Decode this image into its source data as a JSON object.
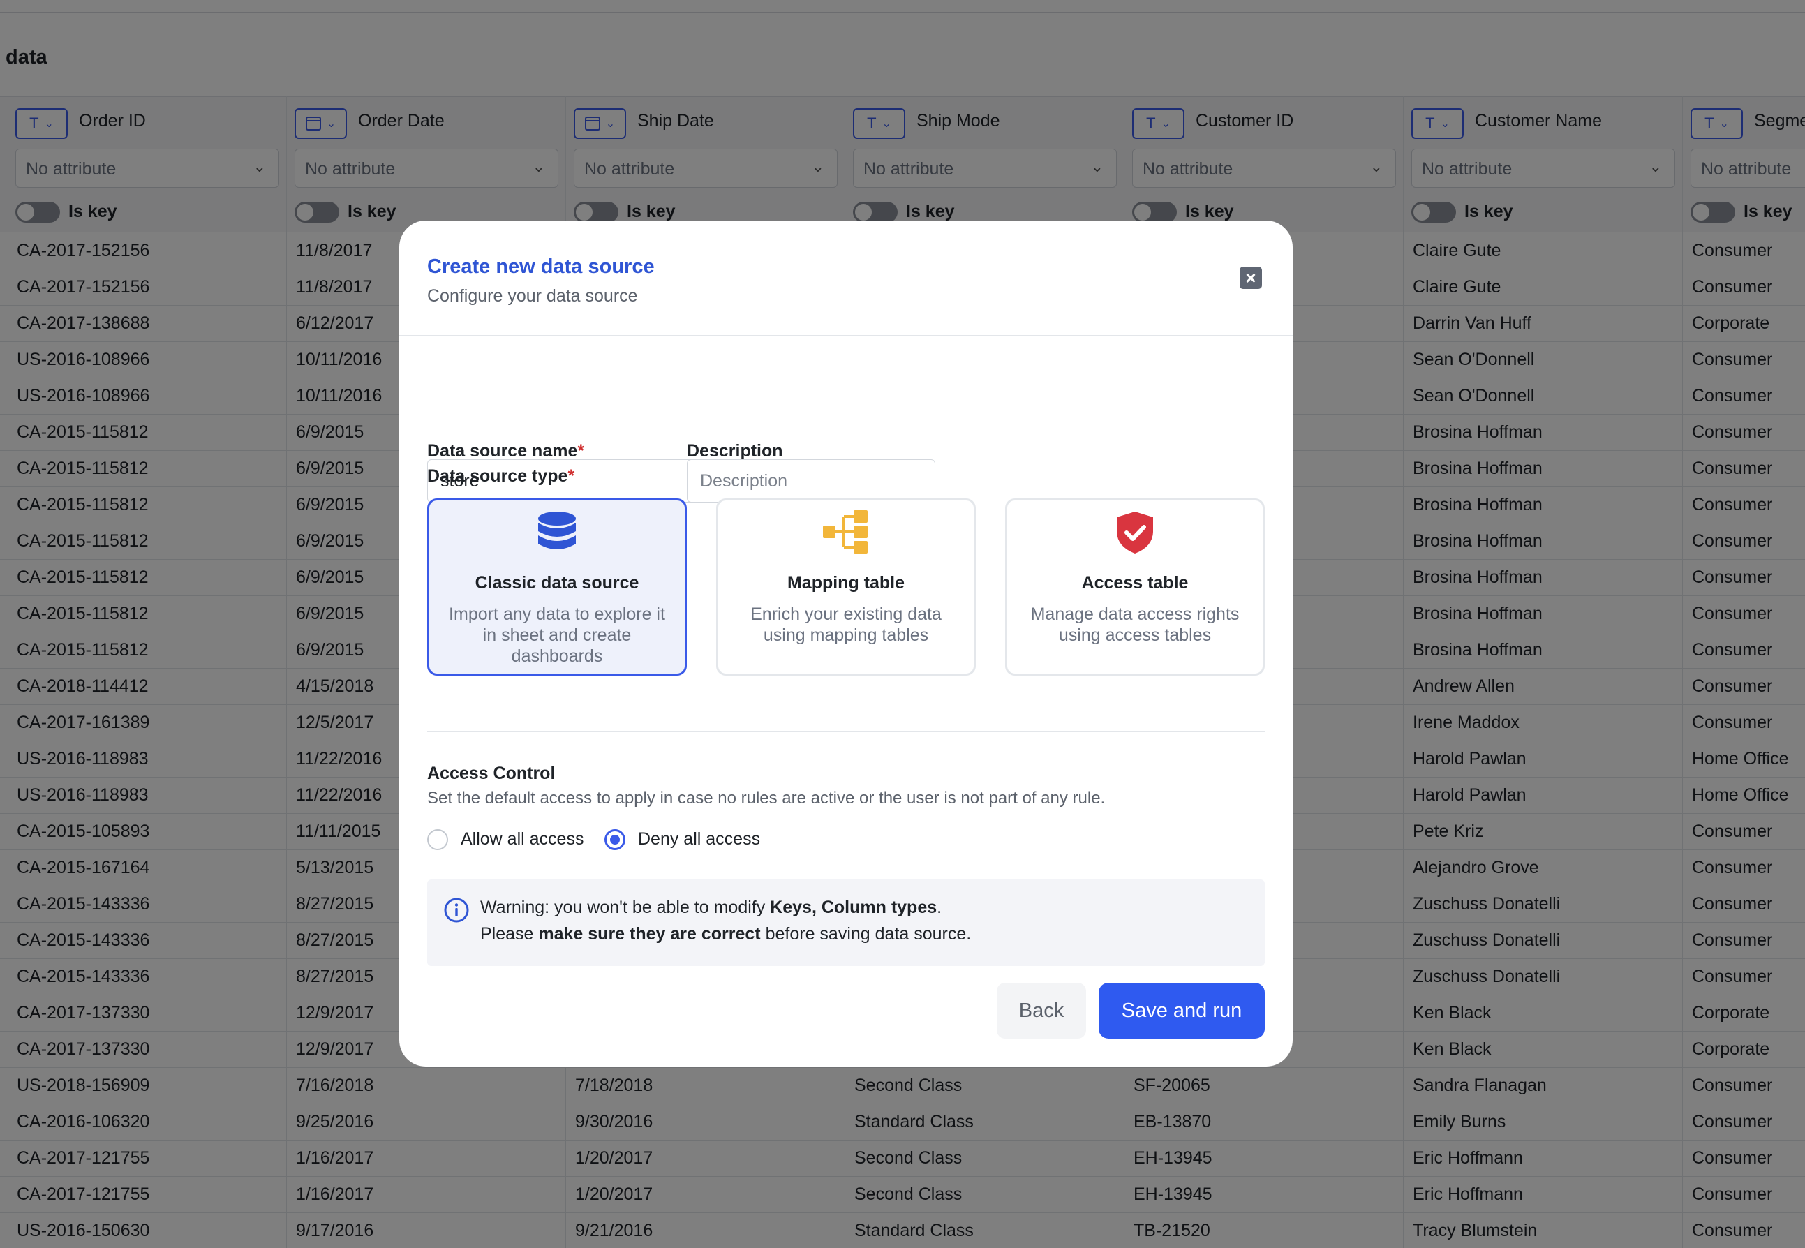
{
  "background": {
    "title": "data",
    "columns": [
      {
        "type_icon": "text-type-icon",
        "name": "Order ID",
        "attribute": "No attribute",
        "key_label": "Is key"
      },
      {
        "type_icon": "calendar-icon",
        "name": "Order Date",
        "attribute": "No attribute",
        "key_label": "Is key"
      },
      {
        "type_icon": "calendar-icon",
        "name": "Ship Date",
        "attribute": "No attribute",
        "key_label": "Is key"
      },
      {
        "type_icon": "text-type-icon",
        "name": "Ship Mode",
        "attribute": "No attribute",
        "key_label": "Is key"
      },
      {
        "type_icon": "text-type-icon",
        "name": "Customer ID",
        "attribute": "No attribute",
        "key_label": "Is key"
      },
      {
        "type_icon": "text-type-icon",
        "name": "Customer Name",
        "attribute": "No attribute",
        "key_label": "Is key"
      },
      {
        "type_icon": "text-type-icon",
        "name": "Segme",
        "attribute": "No attribute",
        "key_label": "Is key"
      }
    ],
    "rows": [
      [
        "CA-2017-152156",
        "11/8/2017",
        "",
        "",
        "",
        "Claire Gute",
        "Consumer"
      ],
      [
        "CA-2017-152156",
        "11/8/2017",
        "",
        "",
        "",
        "Claire Gute",
        "Consumer"
      ],
      [
        "CA-2017-138688",
        "6/12/2017",
        "",
        "",
        "",
        "Darrin Van Huff",
        "Corporate"
      ],
      [
        "US-2016-108966",
        "10/11/2016",
        "",
        "",
        "",
        "Sean O'Donnell",
        "Consumer"
      ],
      [
        "US-2016-108966",
        "10/11/2016",
        "",
        "",
        "",
        "Sean O'Donnell",
        "Consumer"
      ],
      [
        "CA-2015-115812",
        "6/9/2015",
        "",
        "",
        "",
        "Brosina Hoffman",
        "Consumer"
      ],
      [
        "CA-2015-115812",
        "6/9/2015",
        "",
        "",
        "",
        "Brosina Hoffman",
        "Consumer"
      ],
      [
        "CA-2015-115812",
        "6/9/2015",
        "",
        "",
        "",
        "Brosina Hoffman",
        "Consumer"
      ],
      [
        "CA-2015-115812",
        "6/9/2015",
        "",
        "",
        "",
        "Brosina Hoffman",
        "Consumer"
      ],
      [
        "CA-2015-115812",
        "6/9/2015",
        "",
        "",
        "",
        "Brosina Hoffman",
        "Consumer"
      ],
      [
        "CA-2015-115812",
        "6/9/2015",
        "",
        "",
        "",
        "Brosina Hoffman",
        "Consumer"
      ],
      [
        "CA-2015-115812",
        "6/9/2015",
        "",
        "",
        "",
        "Brosina Hoffman",
        "Consumer"
      ],
      [
        "CA-2018-114412",
        "4/15/2018",
        "",
        "",
        "",
        "Andrew Allen",
        "Consumer"
      ],
      [
        "CA-2017-161389",
        "12/5/2017",
        "",
        "",
        "",
        "Irene Maddox",
        "Consumer"
      ],
      [
        "US-2016-118983",
        "11/22/2016",
        "",
        "",
        "",
        "Harold Pawlan",
        "Home Office"
      ],
      [
        "US-2016-118983",
        "11/22/2016",
        "",
        "",
        "",
        "Harold Pawlan",
        "Home Office"
      ],
      [
        "CA-2015-105893",
        "11/11/2015",
        "",
        "",
        "",
        "Pete Kriz",
        "Consumer"
      ],
      [
        "CA-2015-167164",
        "5/13/2015",
        "",
        "",
        "",
        "Alejandro Grove",
        "Consumer"
      ],
      [
        "CA-2015-143336",
        "8/27/2015",
        "",
        "",
        "",
        "Zuschuss Donatelli",
        "Consumer"
      ],
      [
        "CA-2015-143336",
        "8/27/2015",
        "",
        "",
        "",
        "Zuschuss Donatelli",
        "Consumer"
      ],
      [
        "CA-2015-143336",
        "8/27/2015",
        "",
        "",
        "",
        "Zuschuss Donatelli",
        "Consumer"
      ],
      [
        "CA-2017-137330",
        "12/9/2017",
        "",
        "",
        "",
        "Ken Black",
        "Corporate"
      ],
      [
        "CA-2017-137330",
        "12/9/2017",
        "",
        "",
        "",
        "Ken Black",
        "Corporate"
      ],
      [
        "US-2018-156909",
        "7/16/2018",
        "7/18/2018",
        "Second Class",
        "SF-20065",
        "Sandra Flanagan",
        "Consumer"
      ],
      [
        "CA-2016-106320",
        "9/25/2016",
        "9/30/2016",
        "Standard Class",
        "EB-13870",
        "Emily Burns",
        "Consumer"
      ],
      [
        "CA-2017-121755",
        "1/16/2017",
        "1/20/2017",
        "Second Class",
        "EH-13945",
        "Eric Hoffmann",
        "Consumer"
      ],
      [
        "CA-2017-121755",
        "1/16/2017",
        "1/20/2017",
        "Second Class",
        "EH-13945",
        "Eric Hoffmann",
        "Consumer"
      ],
      [
        "US-2016-150630",
        "9/17/2016",
        "9/21/2016",
        "Standard Class",
        "TB-21520",
        "Tracy Blumstein",
        "Consumer"
      ]
    ]
  },
  "modal": {
    "title": "Create new data source",
    "subtitle": "Configure your data source",
    "close_icon": "close-icon",
    "name_label": "Data source name",
    "required_mark": "*",
    "name_value": "store",
    "description_label": "Description",
    "description_placeholder": "Description",
    "type_label": "Data source type",
    "types": [
      {
        "icon": "database-icon",
        "title": "Classic data source",
        "desc": "Import any data to explore it in sheet and create dashboards",
        "selected": true
      },
      {
        "icon": "mapping-icon",
        "title": "Mapping table",
        "desc": "Enrich your existing data using mapping tables",
        "selected": false
      },
      {
        "icon": "shield-check-icon",
        "title": "Access table",
        "desc": "Manage data access rights using access tables",
        "selected": false
      }
    ],
    "access_title": "Access Control",
    "access_desc": "Set the default access to apply in case no rules are active or the user is not part of any rule.",
    "allow_label": "Allow all access",
    "deny_label": "Deny all access",
    "selected_access": "deny",
    "warning": {
      "icon": "info-icon",
      "line1_prefix": "Warning: you won't be able to modify ",
      "line1_bold": "Keys, Column types",
      "line1_suffix": ".",
      "line2_prefix": "Please ",
      "line2_bold": "make sure they are correct",
      "line2_suffix": " before saving data source."
    },
    "back_label": "Back",
    "save_label": "Save and run"
  },
  "colors": {
    "accent": "#2f5af0",
    "title_blue": "#2f55d4",
    "required_red": "#d03030",
    "mapping_yellow": "#f2b63a",
    "access_red": "#d9353f"
  }
}
